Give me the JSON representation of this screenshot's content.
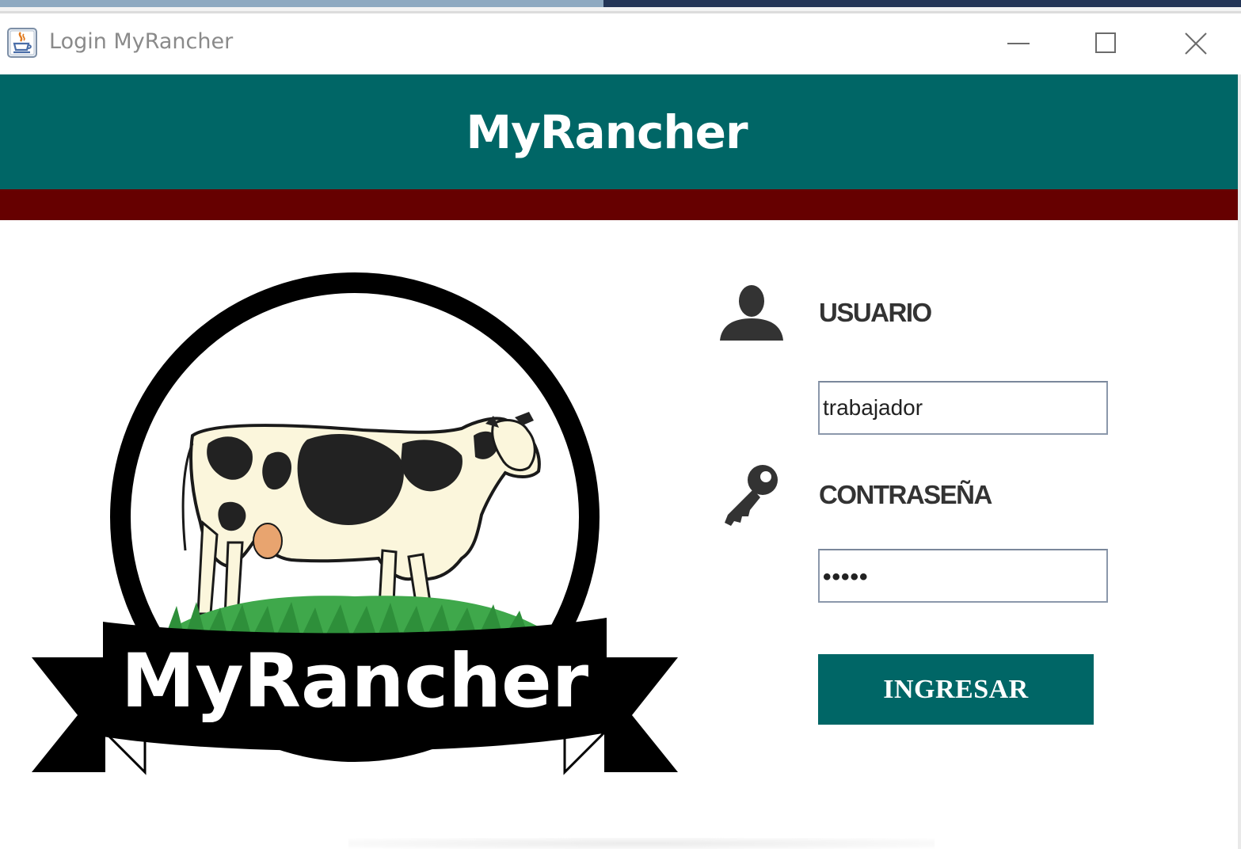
{
  "window": {
    "title": "Login MyRancher",
    "icon": "java-cup-icon"
  },
  "header": {
    "title": "MyRancher",
    "color": "#006666",
    "band_color": "#660000"
  },
  "logo": {
    "banner_text": "MyRancher"
  },
  "form": {
    "user_label": "USUARIO",
    "user_value": "trabajador",
    "user_icon": "user-icon",
    "password_label": "CONTRASEÑA",
    "password_value": "•••••",
    "password_icon": "key-icon",
    "submit_label": "INGRESAR"
  }
}
